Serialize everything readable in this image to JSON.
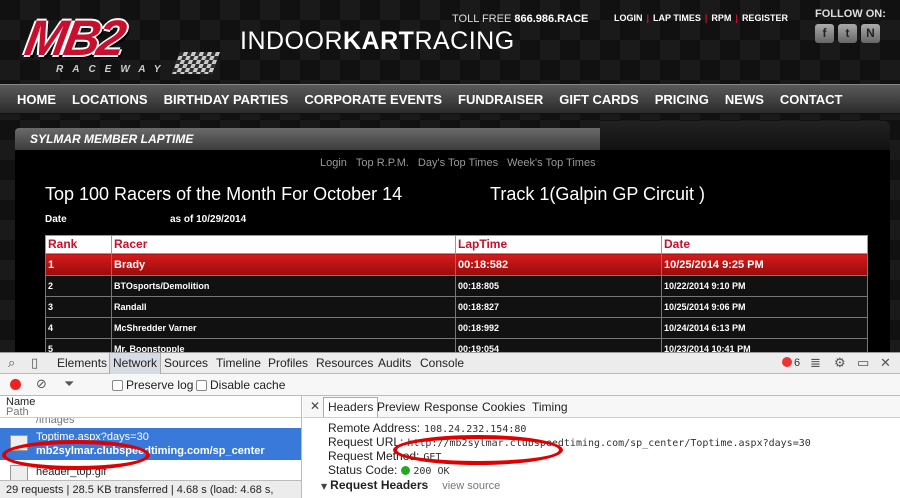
{
  "site": {
    "logo_text": "MB2",
    "logo_sub": "RACEWAY",
    "brand_light": "INDOOR",
    "brand_bold": "KART",
    "brand_end": "RACING",
    "toll_free_label": "TOLL FREE",
    "toll_free_number": "866.986.RACE",
    "top_links": [
      "LOGIN",
      "LAP TIMES",
      "RPM",
      "REGISTER"
    ],
    "follow_label": "FOLLOW ON:",
    "social": [
      {
        "name": "facebook-icon",
        "glyph": "f"
      },
      {
        "name": "twitter-icon",
        "glyph": "t"
      },
      {
        "name": "news-icon",
        "glyph": "N"
      }
    ],
    "nav": [
      "HOME",
      "LOCATIONS",
      "BIRTHDAY PARTIES",
      "CORPORATE EVENTS",
      "FUNDRAISER",
      "GIFT CARDS",
      "PRICING",
      "NEWS",
      "CONTACT"
    ],
    "panel_title": "SYLMAR MEMBER LAPTIME",
    "sub_links": [
      "Login",
      "Top R.P.M.",
      "Day's Top Times",
      "Week's Top Times"
    ],
    "heading": "Top 100 Racers of the Month For October 14",
    "track": "Track 1(Galpin GP Circuit )",
    "date_label": "Date",
    "date_value": "as of 10/29/2014",
    "table": {
      "headers": [
        "Rank",
        "Racer",
        "LapTime",
        "Date"
      ],
      "rows": [
        [
          "1",
          "Brady",
          "00:18:582",
          "10/25/2014 9:25 PM"
        ],
        [
          "2",
          "BTOsports/Demolition",
          "00:18:805",
          "10/22/2014 9:10 PM"
        ],
        [
          "3",
          "Randall",
          "00:18:827",
          "10/25/2014 9:06 PM"
        ],
        [
          "4",
          "McShredder Varner",
          "00:18:992",
          "10/24/2014 6:13 PM"
        ],
        [
          "5",
          "Mr. Boonstopple",
          "00:19:054",
          "10/23/2014 10:41 PM"
        ]
      ]
    }
  },
  "devtools": {
    "tabs": [
      "Elements",
      "Network",
      "Sources",
      "Timeline",
      "Profiles",
      "Resources",
      "Audits",
      "Console"
    ],
    "active_tab": "Network",
    "error_count": "6",
    "preserve_log": "Preserve log",
    "disable_cache": "Disable cache",
    "col_name": "Name",
    "col_path": "Path",
    "requests": [
      {
        "name": "",
        "path": "/images"
      },
      {
        "name": "Toptime.aspx?days=30",
        "path": "mb2sylmar.clubspeedtiming.com/sp_center"
      },
      {
        "name": "header_top.gif",
        "path": ""
      }
    ],
    "status_line": "29 requests | 28.5 KB transferred | 4.68 s (load: 4.68 s,",
    "detail_tabs": [
      "Headers",
      "Preview",
      "Response",
      "Cookies",
      "Timing"
    ],
    "headers": {
      "remote_label": "Remote Address:",
      "remote_value": "108.24.232.154:80",
      "url_label": "Request URL:",
      "url_value": "http://mb2sylmar.clubspeedtiming.com/sp_center/Toptime.aspx?days=30",
      "method_label": "Request Method:",
      "method_value": "GET",
      "status_label": "Status Code:",
      "status_value": "200 OK",
      "req_headers_label": "Request Headers",
      "view_source": "view source"
    }
  }
}
